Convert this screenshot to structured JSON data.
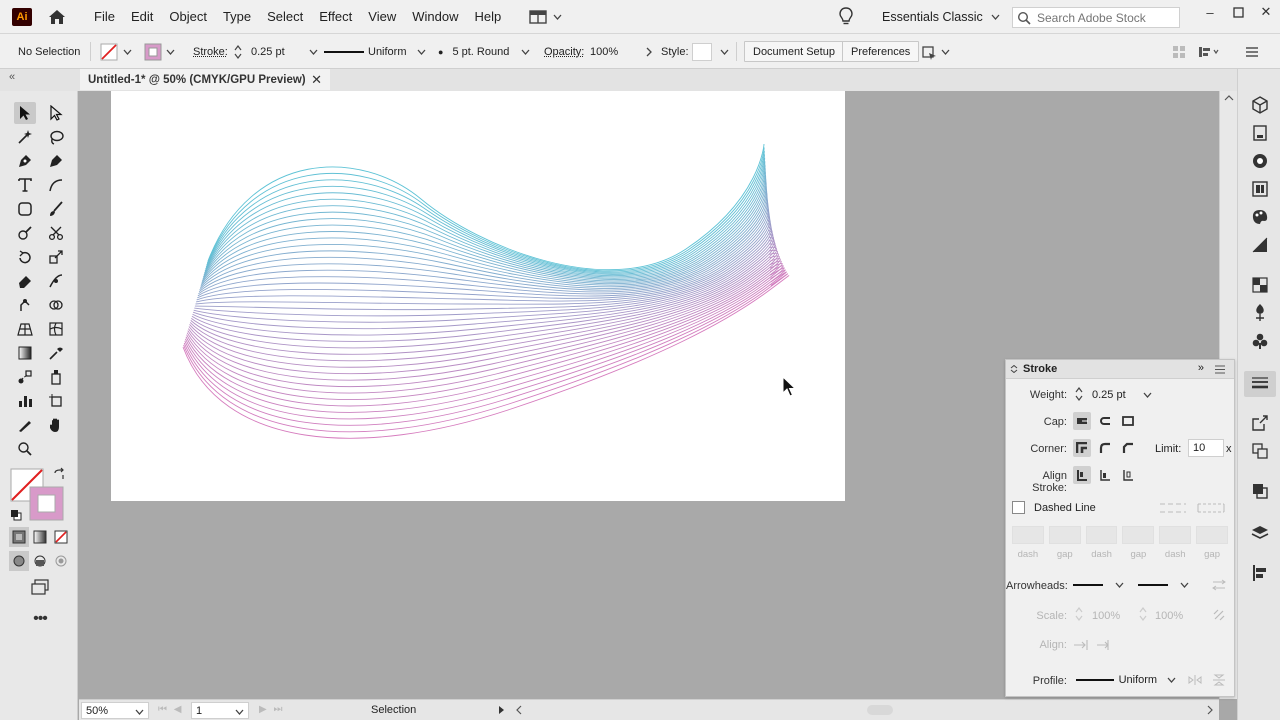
{
  "app": {
    "logo": "Ai"
  },
  "menu": [
    "File",
    "Edit",
    "Object",
    "Type",
    "Select",
    "Effect",
    "View",
    "Window",
    "Help"
  ],
  "workspace": {
    "label": "Essentials Classic"
  },
  "search": {
    "placeholder": "Search Adobe Stock"
  },
  "control": {
    "selection": "No Selection",
    "stroke_label": "Stroke:",
    "stroke_weight": "0.25 pt",
    "profile": "Uniform",
    "brush": "5 pt. Round",
    "opacity_label": "Opacity:",
    "opacity": "100%",
    "style_label": "Style:",
    "document_setup": "Document Setup",
    "preferences": "Preferences"
  },
  "document": {
    "tab_title": "Untitled-1* @ 50% (CMYK/GPU Preview)"
  },
  "colors": {
    "line_top": "#5ec3d6",
    "line_bottom": "#d67cbe",
    "fill_swatch": "#d89ac9"
  },
  "status": {
    "zoom": "50%",
    "artboard": "1",
    "tool": "Selection"
  },
  "stroke_panel": {
    "title": "Stroke",
    "weight_label": "Weight:",
    "weight": "0.25 pt",
    "cap_label": "Cap:",
    "corner_label": "Corner:",
    "limit_label": "Limit:",
    "limit": "10",
    "limit_unit": "x",
    "align_label": "Align Stroke:",
    "dashed_line": "Dashed Line",
    "dash_labels": [
      "dash",
      "gap",
      "dash",
      "gap",
      "dash",
      "gap"
    ],
    "arrowheads_label": "Arrowheads:",
    "scale_label": "Scale:",
    "scale_1": "100%",
    "scale_2": "100%",
    "align2_label": "Align:",
    "profile_label": "Profile:",
    "profile": "Uniform"
  }
}
